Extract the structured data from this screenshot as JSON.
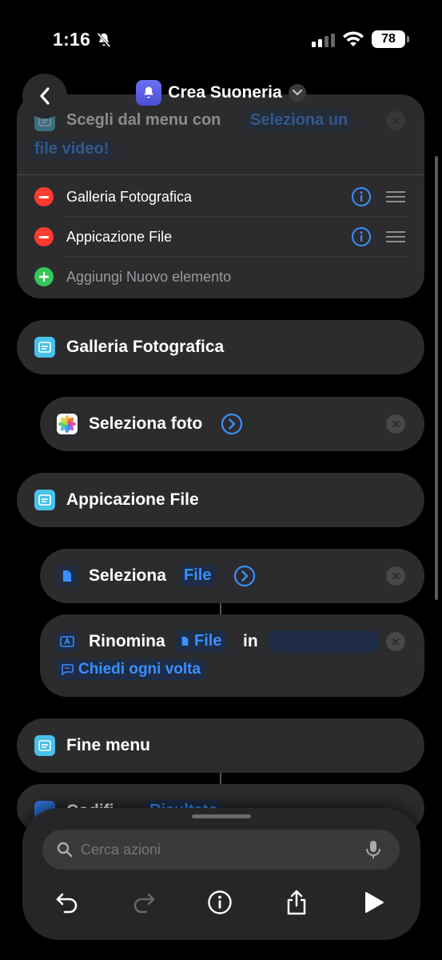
{
  "status": {
    "time": "1:16",
    "battery": "78"
  },
  "header": {
    "title": "Crea Suoneria"
  },
  "menu_card": {
    "prompt_label": "Scegli dal menu con",
    "prompt_token_1": "Seleziona un",
    "prompt_token_2": "file video!",
    "items": [
      {
        "label": "Galleria Fotografica"
      },
      {
        "label": "Appicazione File"
      }
    ],
    "add_label": "Aggiungi Nuovo elemento"
  },
  "case_1": {
    "label": "Galleria Fotografica"
  },
  "select_photo": {
    "label": "Seleziona foto"
  },
  "case_2": {
    "label": "Appicazione File"
  },
  "select_file": {
    "label": "Seleziona",
    "token": "File"
  },
  "rename": {
    "label": "Rinomina",
    "token": "File",
    "in": "in",
    "ask": "Chiedi ogni volta"
  },
  "end_menu": {
    "label": "Fine menu"
  },
  "partial": {
    "label": "Codifi",
    "token": "Risultato"
  },
  "search": {
    "placeholder": "Cerca azioni"
  },
  "colors": {
    "accent": "#3a8fff",
    "card": "#2c2c2e",
    "category": "#49c1e8",
    "remove": "#ff3b30",
    "add": "#34c759"
  }
}
